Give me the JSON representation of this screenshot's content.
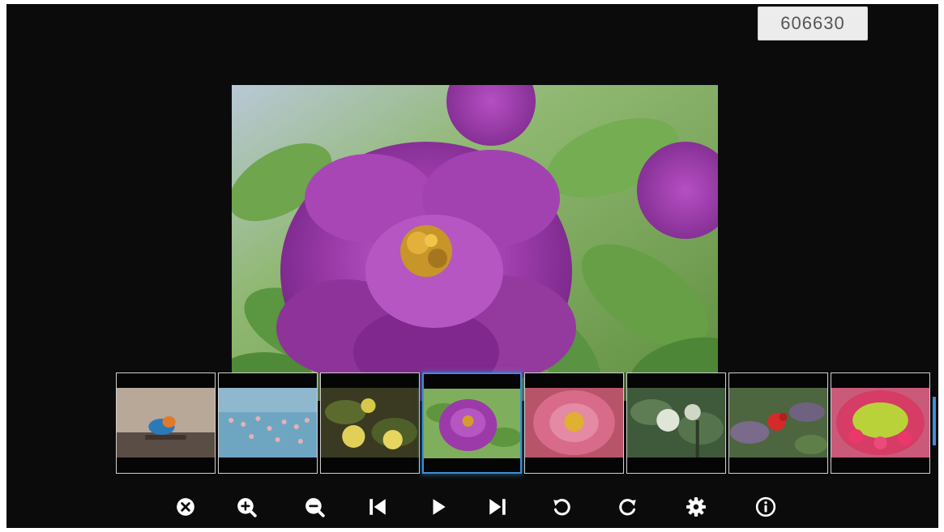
{
  "viewer": {
    "image_number": "606630",
    "current_photo": "purple-peony"
  },
  "thumbnails": [
    {
      "subject": "kingfisher-bird",
      "selected": false
    },
    {
      "subject": "flamingos-lake",
      "selected": false
    },
    {
      "subject": "yellow-flowers",
      "selected": false
    },
    {
      "subject": "purple-peony",
      "selected": true
    },
    {
      "subject": "pink-peony",
      "selected": false
    },
    {
      "subject": "white-hydrangea-tree",
      "selected": false
    },
    {
      "subject": "red-flower-foliage",
      "selected": false
    },
    {
      "subject": "rose-bouquet",
      "selected": false
    }
  ],
  "controls": [
    {
      "action": "close",
      "icon": "close-icon"
    },
    {
      "action": "zoom-in",
      "icon": "zoom-in-icon"
    },
    {
      "action": "zoom-out",
      "icon": "zoom-out-icon"
    },
    {
      "action": "previous",
      "icon": "skip-previous-icon"
    },
    {
      "action": "play",
      "icon": "play-icon"
    },
    {
      "action": "next",
      "icon": "skip-next-icon"
    },
    {
      "action": "rotate-left",
      "icon": "rotate-left-icon"
    },
    {
      "action": "rotate-right",
      "icon": "rotate-right-icon"
    },
    {
      "action": "settings",
      "icon": "gear-icon"
    },
    {
      "action": "info",
      "icon": "info-icon"
    }
  ],
  "colors": {
    "background": "#0b0b0b",
    "selection_border": "#3d8fd6",
    "thumb_border": "#cfcfcf",
    "icon": "#ffffff"
  }
}
